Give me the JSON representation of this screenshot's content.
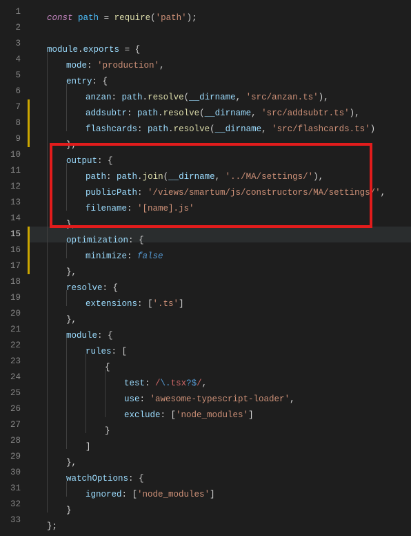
{
  "editor": {
    "highlighted_line": 15,
    "change_bars": [
      {
        "start": 7,
        "end": 9
      },
      {
        "start": 15,
        "end": 17
      }
    ],
    "red_box": {
      "start": 10,
      "end": 14
    },
    "lines": [
      {
        "n": 1,
        "indent": 1,
        "tokens": [
          {
            "t": "const",
            "c": "t-keyword"
          },
          {
            "t": " ",
            "c": ""
          },
          {
            "t": "path",
            "c": "t-ident"
          },
          {
            "t": " ",
            "c": ""
          },
          {
            "t": "=",
            "c": "t-punc"
          },
          {
            "t": " ",
            "c": ""
          },
          {
            "t": "require",
            "c": "t-func"
          },
          {
            "t": "(",
            "c": "t-punc"
          },
          {
            "t": "'path'",
            "c": "t-string"
          },
          {
            "t": ");",
            "c": "t-punc"
          }
        ]
      },
      {
        "n": 2,
        "indent": 0,
        "tokens": []
      },
      {
        "n": 3,
        "indent": 1,
        "tokens": [
          {
            "t": "module",
            "c": "t-var"
          },
          {
            "t": ".",
            "c": "t-punc"
          },
          {
            "t": "exports",
            "c": "t-prop"
          },
          {
            "t": " ",
            "c": ""
          },
          {
            "t": "=",
            "c": "t-punc"
          },
          {
            "t": " ",
            "c": ""
          },
          {
            "t": "{",
            "c": "t-punc"
          }
        ]
      },
      {
        "n": 4,
        "indent": 2,
        "tokens": [
          {
            "t": "mode",
            "c": "t-prop"
          },
          {
            "t": ": ",
            "c": "t-punc"
          },
          {
            "t": "'production'",
            "c": "t-string"
          },
          {
            "t": ",",
            "c": "t-punc"
          }
        ]
      },
      {
        "n": 5,
        "indent": 2,
        "tokens": [
          {
            "t": "entry",
            "c": "t-prop"
          },
          {
            "t": ": ",
            "c": "t-punc"
          },
          {
            "t": "{",
            "c": "t-punc"
          }
        ]
      },
      {
        "n": 6,
        "indent": 3,
        "tokens": [
          {
            "t": "anzan",
            "c": "t-prop"
          },
          {
            "t": ": ",
            "c": "t-punc"
          },
          {
            "t": "path",
            "c": "t-var"
          },
          {
            "t": ".",
            "c": "t-punc"
          },
          {
            "t": "resolve",
            "c": "t-func"
          },
          {
            "t": "(",
            "c": "t-punc"
          },
          {
            "t": "__dirname",
            "c": "t-var"
          },
          {
            "t": ", ",
            "c": "t-punc"
          },
          {
            "t": "'src/anzan.ts'",
            "c": "t-string"
          },
          {
            "t": "),",
            "c": "t-punc"
          }
        ]
      },
      {
        "n": 7,
        "indent": 3,
        "tokens": [
          {
            "t": "addsubtr",
            "c": "t-prop"
          },
          {
            "t": ": ",
            "c": "t-punc"
          },
          {
            "t": "path",
            "c": "t-var"
          },
          {
            "t": ".",
            "c": "t-punc"
          },
          {
            "t": "resolve",
            "c": "t-func"
          },
          {
            "t": "(",
            "c": "t-punc"
          },
          {
            "t": "__dirname",
            "c": "t-var"
          },
          {
            "t": ", ",
            "c": "t-punc"
          },
          {
            "t": "'src/addsubtr.ts'",
            "c": "t-string"
          },
          {
            "t": "),",
            "c": "t-punc"
          }
        ]
      },
      {
        "n": 8,
        "indent": 3,
        "tokens": [
          {
            "t": "flashcards",
            "c": "t-prop"
          },
          {
            "t": ": ",
            "c": "t-punc"
          },
          {
            "t": "path",
            "c": "t-var"
          },
          {
            "t": ".",
            "c": "t-punc"
          },
          {
            "t": "resolve",
            "c": "t-func"
          },
          {
            "t": "(",
            "c": "t-punc"
          },
          {
            "t": "__dirname",
            "c": "t-var"
          },
          {
            "t": ", ",
            "c": "t-punc"
          },
          {
            "t": "'src/flashcards.ts'",
            "c": "t-string"
          },
          {
            "t": ")",
            "c": "t-punc"
          }
        ]
      },
      {
        "n": 9,
        "indent": 2,
        "tokens": [
          {
            "t": "},",
            "c": "t-punc"
          }
        ]
      },
      {
        "n": 10,
        "indent": 2,
        "tokens": [
          {
            "t": "output",
            "c": "t-prop"
          },
          {
            "t": ": ",
            "c": "t-punc"
          },
          {
            "t": "{",
            "c": "t-punc"
          }
        ]
      },
      {
        "n": 11,
        "indent": 3,
        "tokens": [
          {
            "t": "path",
            "c": "t-prop"
          },
          {
            "t": ": ",
            "c": "t-punc"
          },
          {
            "t": "path",
            "c": "t-var"
          },
          {
            "t": ".",
            "c": "t-punc"
          },
          {
            "t": "join",
            "c": "t-func"
          },
          {
            "t": "(",
            "c": "t-punc"
          },
          {
            "t": "__dirname",
            "c": "t-var"
          },
          {
            "t": ", ",
            "c": "t-punc"
          },
          {
            "t": "'../MA/settings/'",
            "c": "t-string"
          },
          {
            "t": "),",
            "c": "t-punc"
          }
        ]
      },
      {
        "n": 12,
        "indent": 3,
        "tokens": [
          {
            "t": "publicPath",
            "c": "t-prop"
          },
          {
            "t": ": ",
            "c": "t-punc"
          },
          {
            "t": "'/views/smartum/js/constructors/MA/settings/'",
            "c": "t-string"
          },
          {
            "t": ",",
            "c": "t-punc"
          }
        ]
      },
      {
        "n": 13,
        "indent": 3,
        "tokens": [
          {
            "t": "filename",
            "c": "t-prop"
          },
          {
            "t": ": ",
            "c": "t-punc"
          },
          {
            "t": "'[name].js'",
            "c": "t-string"
          }
        ]
      },
      {
        "n": 14,
        "indent": 2,
        "tokens": [
          {
            "t": "},",
            "c": "t-punc"
          }
        ]
      },
      {
        "n": 15,
        "indent": 2,
        "tokens": [
          {
            "t": "optimization",
            "c": "t-prop"
          },
          {
            "t": ": ",
            "c": "t-punc"
          },
          {
            "t": "{",
            "c": "t-punc"
          }
        ]
      },
      {
        "n": 16,
        "indent": 3,
        "tokens": [
          {
            "t": "minimize",
            "c": "t-prop"
          },
          {
            "t": ": ",
            "c": "t-punc"
          },
          {
            "t": "false",
            "c": "t-false"
          }
        ]
      },
      {
        "n": 17,
        "indent": 2,
        "tokens": [
          {
            "t": "},",
            "c": "t-punc"
          }
        ]
      },
      {
        "n": 18,
        "indent": 2,
        "tokens": [
          {
            "t": "resolve",
            "c": "t-prop"
          },
          {
            "t": ": ",
            "c": "t-punc"
          },
          {
            "t": "{",
            "c": "t-punc"
          }
        ]
      },
      {
        "n": 19,
        "indent": 3,
        "tokens": [
          {
            "t": "extensions",
            "c": "t-prop"
          },
          {
            "t": ": ",
            "c": "t-punc"
          },
          {
            "t": "[",
            "c": "t-punc"
          },
          {
            "t": "'.ts'",
            "c": "t-string"
          },
          {
            "t": "]",
            "c": "t-punc"
          }
        ]
      },
      {
        "n": 20,
        "indent": 2,
        "tokens": [
          {
            "t": "},",
            "c": "t-punc"
          }
        ]
      },
      {
        "n": 21,
        "indent": 2,
        "tokens": [
          {
            "t": "module",
            "c": "t-prop"
          },
          {
            "t": ": ",
            "c": "t-punc"
          },
          {
            "t": "{",
            "c": "t-punc"
          }
        ]
      },
      {
        "n": 22,
        "indent": 3,
        "tokens": [
          {
            "t": "rules",
            "c": "t-prop"
          },
          {
            "t": ": ",
            "c": "t-punc"
          },
          {
            "t": "[",
            "c": "t-punc"
          }
        ]
      },
      {
        "n": 23,
        "indent": 4,
        "tokens": [
          {
            "t": "{",
            "c": "t-punc"
          }
        ]
      },
      {
        "n": 24,
        "indent": 5,
        "tokens": [
          {
            "t": "test",
            "c": "t-prop"
          },
          {
            "t": ": ",
            "c": "t-punc"
          },
          {
            "t": "/",
            "c": "t-regex"
          },
          {
            "t": "\\.",
            "c": "t-const"
          },
          {
            "t": "tsx",
            "c": "t-regex"
          },
          {
            "t": "?",
            "c": "t-regexq"
          },
          {
            "t": "$",
            "c": "t-const"
          },
          {
            "t": "/",
            "c": "t-regex"
          },
          {
            "t": ",",
            "c": "t-punc"
          }
        ]
      },
      {
        "n": 25,
        "indent": 5,
        "tokens": [
          {
            "t": "use",
            "c": "t-prop"
          },
          {
            "t": ": ",
            "c": "t-punc"
          },
          {
            "t": "'awesome-typescript-loader'",
            "c": "t-string"
          },
          {
            "t": ",",
            "c": "t-punc"
          }
        ]
      },
      {
        "n": 26,
        "indent": 5,
        "tokens": [
          {
            "t": "exclude",
            "c": "t-prop"
          },
          {
            "t": ": ",
            "c": "t-punc"
          },
          {
            "t": "[",
            "c": "t-punc"
          },
          {
            "t": "'node_modules'",
            "c": "t-string"
          },
          {
            "t": "]",
            "c": "t-punc"
          }
        ]
      },
      {
        "n": 27,
        "indent": 4,
        "tokens": [
          {
            "t": "}",
            "c": "t-punc"
          }
        ]
      },
      {
        "n": 28,
        "indent": 3,
        "tokens": [
          {
            "t": "]",
            "c": "t-punc"
          }
        ]
      },
      {
        "n": 29,
        "indent": 2,
        "tokens": [
          {
            "t": "},",
            "c": "t-punc"
          }
        ]
      },
      {
        "n": 30,
        "indent": 2,
        "tokens": [
          {
            "t": "watchOptions",
            "c": "t-prop"
          },
          {
            "t": ": ",
            "c": "t-punc"
          },
          {
            "t": "{",
            "c": "t-punc"
          }
        ]
      },
      {
        "n": 31,
        "indent": 3,
        "tokens": [
          {
            "t": "ignored",
            "c": "t-prop"
          },
          {
            "t": ": ",
            "c": "t-punc"
          },
          {
            "t": "[",
            "c": "t-punc"
          },
          {
            "t": "'node_modules'",
            "c": "t-string"
          },
          {
            "t": "]",
            "c": "t-punc"
          }
        ]
      },
      {
        "n": 32,
        "indent": 2,
        "tokens": [
          {
            "t": "}",
            "c": "t-punc"
          }
        ]
      },
      {
        "n": 33,
        "indent": 1,
        "tokens": [
          {
            "t": "};",
            "c": "t-punc"
          }
        ]
      }
    ]
  }
}
